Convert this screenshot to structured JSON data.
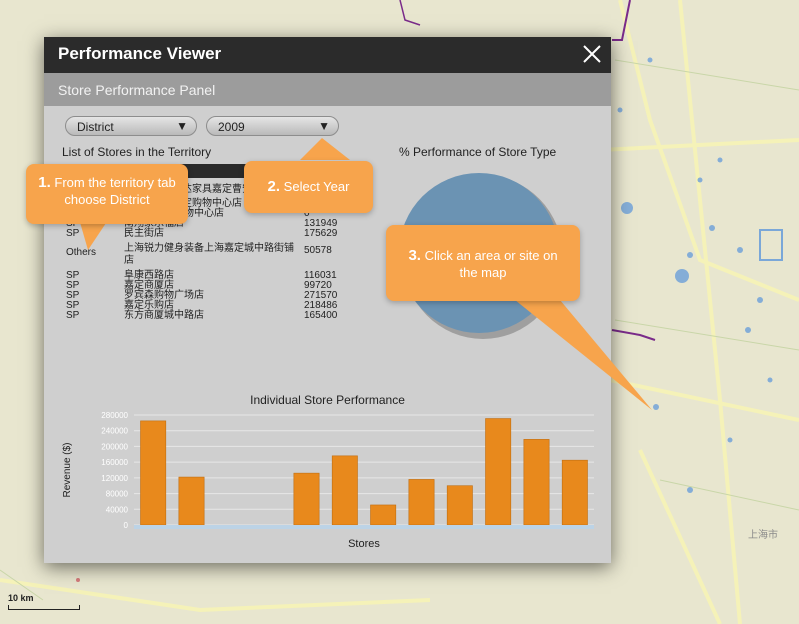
{
  "map": {
    "city_label": "上海市",
    "scale_label": "10 km",
    "colors": {
      "background": "#e8e6cf",
      "road": "#f5f2b8",
      "boundary": "#7a2b8a",
      "water": "#7aa7d8"
    }
  },
  "viewer": {
    "title": "Performance Viewer",
    "panel_title": "Store Performance Panel",
    "district_select": {
      "value": "District"
    },
    "year_select": {
      "value": "2009"
    },
    "list_title": "List of Stores in the Territory",
    "pie_title": "% Performance of Store Type",
    "stores": [
      {
        "type": "",
        "name": "上海科达家具嘉定曹安路",
        "revenue": ""
      },
      {
        "type": "",
        "name": "上海嘉定购物中心店",
        "revenue": ""
      },
      {
        "type": "",
        "name": "上海金沙江购物中心店",
        "revenue": "0"
      },
      {
        "type": "SP",
        "name": "南翔家乐福店",
        "revenue": "131949"
      },
      {
        "type": "SP",
        "name": "民主街店",
        "revenue": "175629"
      },
      {
        "type": "Others",
        "name": "上海锐力健身装备上海嘉定城中路街铺店",
        "revenue": "50578"
      },
      {
        "type": "SP",
        "name": "阜康西路店",
        "revenue": "116031"
      },
      {
        "type": "SP",
        "name": "嘉定商厦店",
        "revenue": "99720"
      },
      {
        "type": "SP",
        "name": "罗宾森购物广场店",
        "revenue": "271570"
      },
      {
        "type": "SP",
        "name": "嘉定乐购店",
        "revenue": "218486"
      },
      {
        "type": "SP",
        "name": "东方商厦城中路店",
        "revenue": "165400"
      }
    ]
  },
  "callouts": [
    {
      "num": "1.",
      "text": "From the territory tab choose District"
    },
    {
      "num": "2.",
      "text": "Select Year"
    },
    {
      "num": "3.",
      "text": "Click an area or site on the map"
    }
  ],
  "chart_data": [
    {
      "type": "pie",
      "title": "% Performance of Store Type",
      "categories": [
        "SP"
      ],
      "values": [
        100
      ],
      "colors": [
        "#6b93b3"
      ]
    },
    {
      "type": "bar",
      "title": "Individual Store Performance",
      "xlabel": "Stores",
      "ylabel": "Revenue ($)",
      "ylim": [
        0,
        280000
      ],
      "yticks": [
        0,
        40000,
        80000,
        120000,
        160000,
        200000,
        240000,
        280000
      ],
      "ytick_labels": [
        "0",
        "40000",
        "80000",
        "120000",
        "160000",
        "200000",
        "240000",
        "280000"
      ],
      "categories": [
        "",
        "",
        "",
        "",
        "",
        "",
        "",
        "",
        "",
        "",
        "",
        "",
        ""
      ],
      "values": [
        265000,
        122000,
        0,
        0,
        132000,
        176000,
        51000,
        116000,
        100000,
        271000,
        218000,
        165000
      ],
      "grid": true,
      "bar_color": "#e8891c"
    }
  ]
}
